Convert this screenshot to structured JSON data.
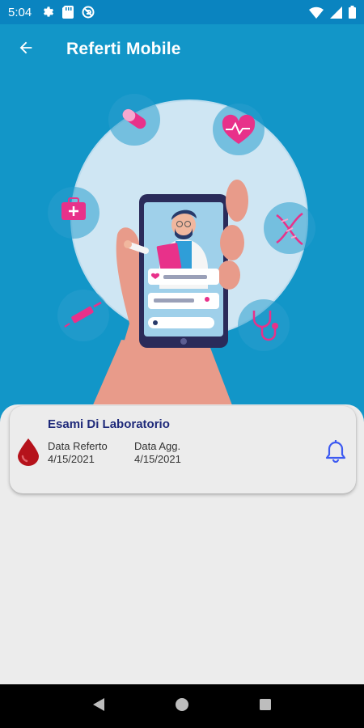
{
  "status_bar": {
    "time": "5:04",
    "left_icons": [
      "gear-icon",
      "sd-card-icon",
      "sync-disabled-icon"
    ],
    "right_icons": [
      "wifi-icon",
      "signal-icon",
      "battery-icon"
    ]
  },
  "app_bar": {
    "title": "Referti Mobile",
    "back_icon": "arrow-left-icon"
  },
  "colors": {
    "status_bar": "#0a84c0",
    "hero": "#1296c8",
    "title_blue": "#1f2a7a",
    "accent_pink": "#e8318a",
    "bell_blue": "#3d5af1",
    "blood_red": "#b5121b"
  },
  "reports": [
    {
      "title": "Esami Di Laboratorio",
      "icon": "blood-drop-icon",
      "report_date_label": "Data Referto",
      "report_date": "4/15/2021",
      "update_date_label": "Data Agg.",
      "update_date": "4/15/2021",
      "action_icon": "bell-icon"
    }
  ],
  "nav_bar": {
    "buttons": [
      "back-triangle-icon",
      "home-circle-icon",
      "recents-square-icon"
    ]
  }
}
